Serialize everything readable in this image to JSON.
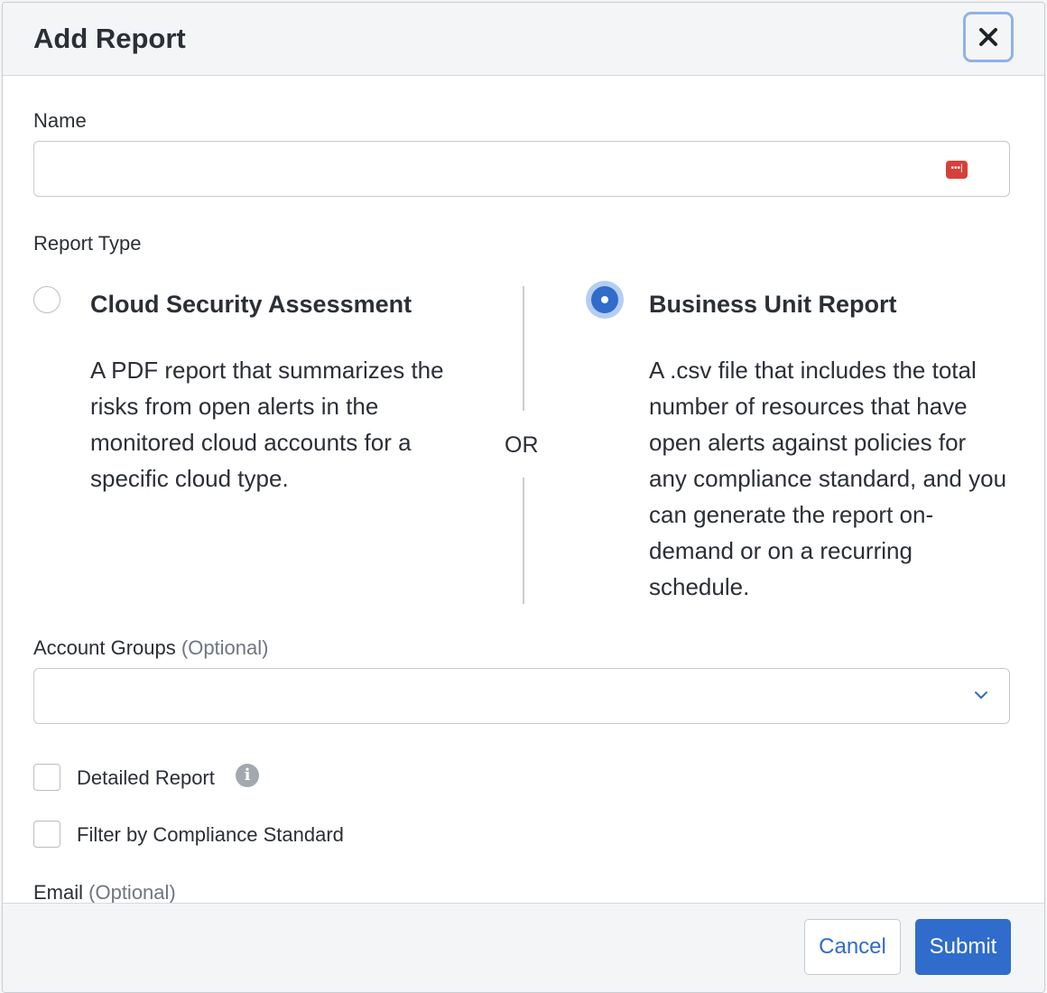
{
  "dialog": {
    "title": "Add Report",
    "close_icon": "close-icon"
  },
  "name_field": {
    "label": "Name",
    "value": "",
    "placeholder": "",
    "icon": "password-manager-icon"
  },
  "report_type": {
    "label": "Report Type",
    "separator": "OR",
    "options": [
      {
        "title": "Cloud Security Assessment",
        "description": "A PDF report that summarizes the risks from open alerts in the monitored cloud accounts for a specific cloud type.",
        "selected": false
      },
      {
        "title": "Business Unit Report",
        "description": "A .csv file that includes the total number of resources that have open alerts against policies for any compliance standard, and you can generate the report on-demand or on a recurring schedule.",
        "selected": true
      }
    ]
  },
  "account_groups": {
    "label": "Account Groups",
    "optional": "(Optional)",
    "value": "",
    "icon": "chevron-down-icon"
  },
  "checkboxes": {
    "detailed_report": {
      "label": "Detailed Report",
      "checked": false,
      "icon": "info-icon"
    },
    "filter_compliance": {
      "label": "Filter by Compliance Standard",
      "checked": false
    }
  },
  "email": {
    "label": "Email",
    "optional": "(Optional)"
  },
  "footer": {
    "cancel_label": "Cancel",
    "submit_label": "Submit"
  },
  "colors": {
    "accent": "#2f6ccb",
    "radio_ring": "#b5cdf2",
    "password_icon": "#d5413a"
  }
}
